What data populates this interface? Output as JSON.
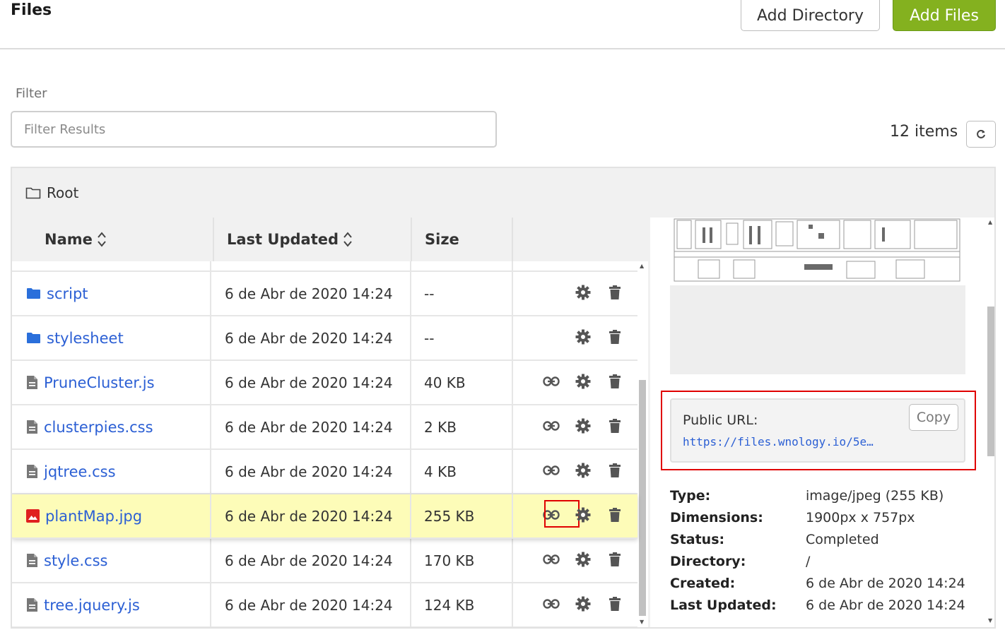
{
  "header": {
    "title": "Files",
    "add_directory_label": "Add Directory",
    "add_files_label": "Add Files"
  },
  "filter": {
    "label": "Filter",
    "placeholder": "Filter Results",
    "value": ""
  },
  "items_count": "12 items",
  "breadcrumb": {
    "root_label": "Root"
  },
  "table": {
    "columns": {
      "name": "Name",
      "last_updated": "Last Updated",
      "size": "Size"
    },
    "rows": [
      {
        "name": "script",
        "type": "folder",
        "last_updated": "6 de Abr de 2020 14:24",
        "size": "--",
        "has_link": false,
        "selected": false
      },
      {
        "name": "stylesheet",
        "type": "folder",
        "last_updated": "6 de Abr de 2020 14:24",
        "size": "--",
        "has_link": false,
        "selected": false
      },
      {
        "name": "PruneCluster.js",
        "type": "file",
        "last_updated": "6 de Abr de 2020 14:24",
        "size": "40 KB",
        "has_link": true,
        "selected": false
      },
      {
        "name": "clusterpies.css",
        "type": "file",
        "last_updated": "6 de Abr de 2020 14:24",
        "size": "2 KB",
        "has_link": true,
        "selected": false
      },
      {
        "name": "jqtree.css",
        "type": "file",
        "last_updated": "6 de Abr de 2020 14:24",
        "size": "4 KB",
        "has_link": true,
        "selected": false
      },
      {
        "name": "plantMap.jpg",
        "type": "image",
        "last_updated": "6 de Abr de 2020 14:24",
        "size": "255 KB",
        "has_link": true,
        "selected": true
      },
      {
        "name": "style.css",
        "type": "file",
        "last_updated": "6 de Abr de 2020 14:24",
        "size": "170 KB",
        "has_link": true,
        "selected": false
      },
      {
        "name": "tree.jquery.js",
        "type": "file",
        "last_updated": "6 de Abr de 2020 14:24",
        "size": "124 KB",
        "has_link": true,
        "selected": false
      }
    ]
  },
  "details": {
    "public_url_label": "Public URL:",
    "public_url_value": "https://files.wnology.io/5e…",
    "copy_label": "Copy",
    "meta": [
      {
        "key": "Type:",
        "value": "image/jpeg (255 KB)"
      },
      {
        "key": "Dimensions:",
        "value": "1900px x 757px"
      },
      {
        "key": "Status:",
        "value": "Completed"
      },
      {
        "key": "Directory:",
        "value": "/"
      },
      {
        "key": "Created:",
        "value": "6 de Abr de 2020 14:24"
      },
      {
        "key": "Last Updated:",
        "value": "6 de Abr de 2020 14:24"
      }
    ]
  },
  "colors": {
    "accent_green": "#84b11f",
    "link_blue": "#2b5fd4",
    "selected_row": "#fdfcb8",
    "highlight_red": "#e00000",
    "image_icon_red": "#e02020"
  },
  "icons": {
    "refresh": "refresh-icon",
    "folder_outline": "folder-outline-icon",
    "folder": "folder-icon",
    "file": "file-icon",
    "image": "image-icon",
    "link": "link-icon",
    "gear": "gear-icon",
    "trash": "trash-icon",
    "sort": "sort-icon"
  }
}
